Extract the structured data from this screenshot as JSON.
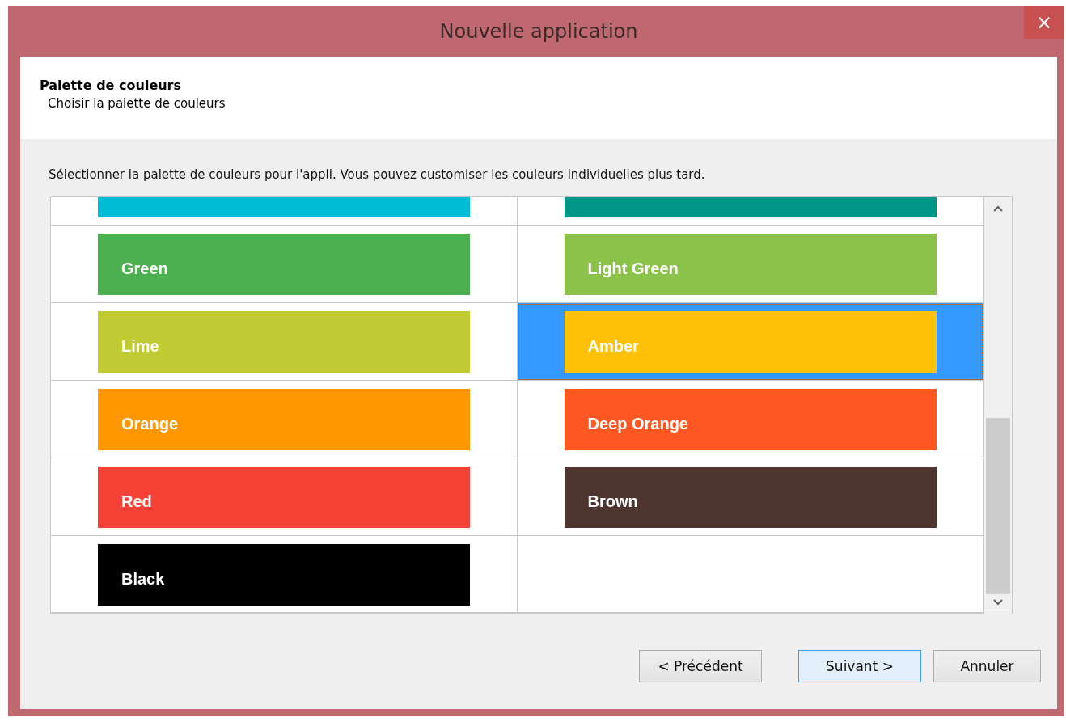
{
  "window": {
    "title": "Nouvelle application",
    "close": "×"
  },
  "header": {
    "title": "Palette de couleurs",
    "subtitle": "Choisir la palette de couleurs"
  },
  "instruction": "Sélectionner la palette de couleurs pour l'appli. Vous pouvez customiser les couleurs individuelles plus tard.",
  "palettes": [
    {
      "color": "#00bcd4",
      "selected": false
    },
    {
      "color": "#009688",
      "selected": false
    },
    {
      "name": "Green",
      "color": "#4caf50",
      "selected": false
    },
    {
      "name": "Light Green",
      "color": "#8bc34a",
      "selected": false
    },
    {
      "name": "Lime",
      "color": "#c0ca33",
      "selected": false
    },
    {
      "name": "Amber",
      "color": "#ffc107",
      "selected": true
    },
    {
      "name": "Orange",
      "color": "#ff9800",
      "selected": false
    },
    {
      "name": "Deep Orange",
      "color": "#ff5722",
      "selected": false
    },
    {
      "name": "Red",
      "color": "#f44336",
      "selected": false
    },
    {
      "name": "Brown",
      "color": "#4e342e",
      "selected": false
    },
    {
      "name": "Black",
      "color": "#000000",
      "selected": false
    }
  ],
  "buttons": [
    {
      "label": "< Précédent",
      "default": false
    },
    {
      "label": "Suivant >",
      "default": true
    },
    {
      "label": "Annuler",
      "default": false
    }
  ]
}
